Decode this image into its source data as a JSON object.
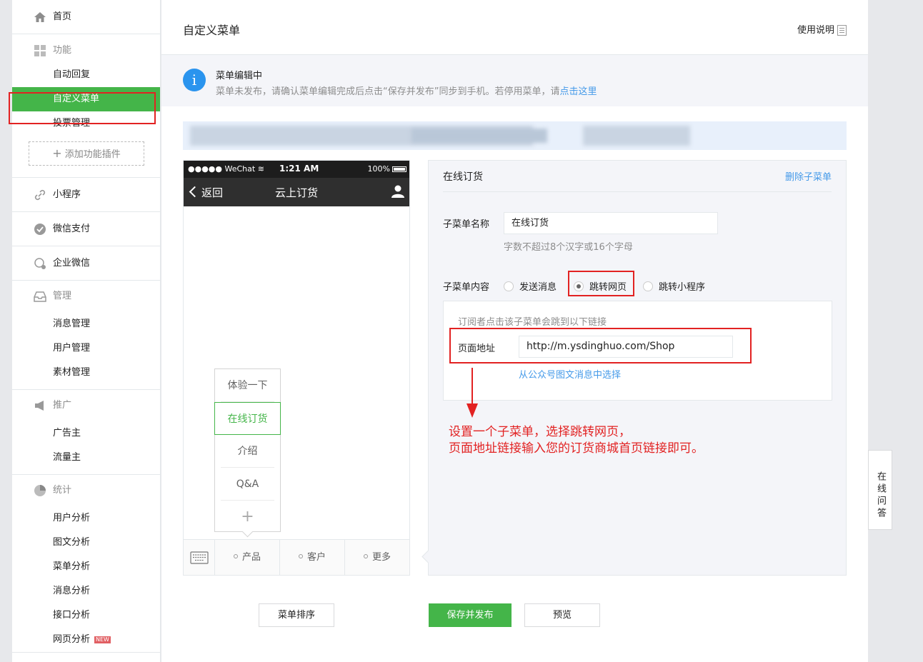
{
  "sidebar": {
    "home": "首页",
    "function": {
      "head": "功能",
      "items": [
        "自动回复",
        "自定义菜单",
        "投票管理"
      ],
      "add_plugin": "添加功能插件"
    },
    "mini_program": "小程序",
    "wechat_pay": "微信支付",
    "enterprise": "企业微信",
    "manage": {
      "head": "管理",
      "items": [
        "消息管理",
        "用户管理",
        "素材管理"
      ]
    },
    "promote": {
      "head": "推广",
      "items": [
        "广告主",
        "流量主"
      ]
    },
    "stats": {
      "head": "统计",
      "items": [
        "用户分析",
        "图文分析",
        "菜单分析",
        "消息分析",
        "接口分析",
        "网页分析"
      ],
      "new_badge": "NEW"
    }
  },
  "header": {
    "title": "自定义菜单",
    "help": "使用说明"
  },
  "notice": {
    "icon": "i",
    "title": "菜单编辑中",
    "text": "菜单未发布，请确认菜单编辑完成后点击“保存并发布”同步到手机。若停用菜单，请",
    "link": "点击这里"
  },
  "phone": {
    "carrier": "●●●●● WeChat",
    "time": "1:21 AM",
    "battery": "100%",
    "back": "返回",
    "title": "云上订货",
    "submenu": [
      "体验一下",
      "在线订货",
      "介绍",
      "Q&A"
    ],
    "plus": "+",
    "bottom_menu": [
      "产品",
      "客户",
      "更多"
    ]
  },
  "editor": {
    "title": "在线订货",
    "delete": "删除子菜单",
    "name_label": "子菜单名称",
    "name_value": "在线订货",
    "name_hint": "字数不超过8个汉字或16个字母",
    "content_label": "子菜单内容",
    "options": [
      "发送消息",
      "跳转网页",
      "跳转小程序"
    ],
    "url_desc": "订阅者点击该子菜单会跳到以下链接",
    "url_label": "页面地址",
    "url_value": "http://m.ysdinghuo.com/Shop",
    "url_link": "从公众号图文消息中选择"
  },
  "annotation": {
    "line1": "设置一个子菜单，选择跳转网页，",
    "line2": "页面地址链接输入您的订货商城首页链接即可。"
  },
  "buttons": {
    "sort": "菜单排序",
    "save": "保存并发布",
    "preview": "预览"
  },
  "float_qa": "在线问答",
  "colors": {
    "accent": "#44b549",
    "link": "#459ae9",
    "annotation": "#e22222",
    "info": "#2a94ee"
  }
}
